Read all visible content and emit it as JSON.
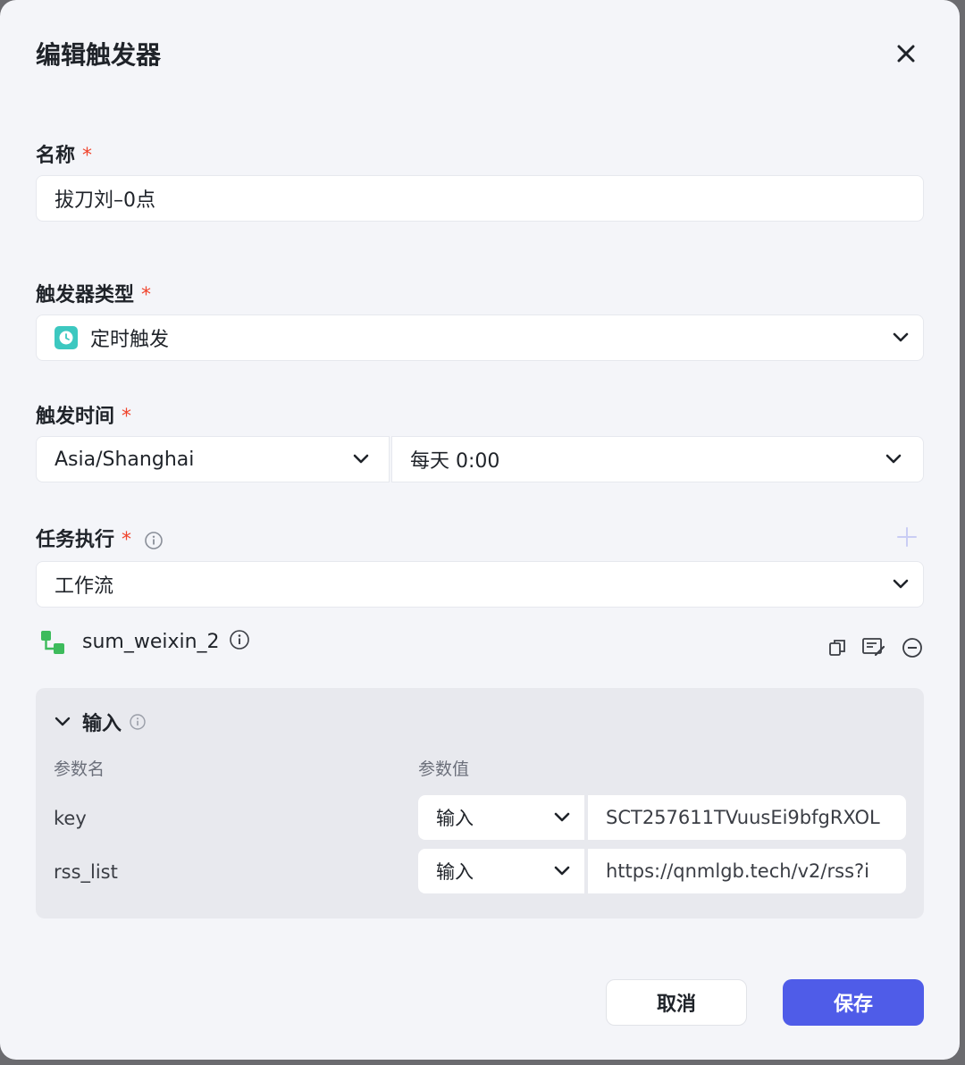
{
  "dialog": {
    "title": "编辑触发器"
  },
  "name_field": {
    "label": "名称",
    "required_mark": "*",
    "value": "拔刀刘–0点"
  },
  "trigger_type": {
    "label": "触发器类型",
    "required_mark": "*",
    "value": "定时触发",
    "icon": "clock-icon",
    "icon_color": "#3cc8c0"
  },
  "trigger_time": {
    "label": "触发时间",
    "required_mark": "*",
    "timezone": "Asia/Shanghai",
    "schedule": "每天 0:00"
  },
  "task": {
    "label": "任务执行",
    "required_mark": "*",
    "type": "工作流",
    "workflow_name": "sum_weixin_2",
    "workflow_icon_color": "#3dbb5c"
  },
  "inputs": {
    "title": "输入",
    "col_name": "参数名",
    "col_value": "参数值",
    "rows": [
      {
        "name": "key",
        "mode": "输入",
        "value": "SCT257611TVuusEi9bfgRXOL"
      },
      {
        "name": "rss_list",
        "mode": "输入",
        "value": "https://qnmlgb.tech/v2/rss?i"
      }
    ]
  },
  "footer": {
    "cancel": "取消",
    "save": "保存"
  },
  "colors": {
    "accent": "#4f5ce8",
    "required": "#f0442c",
    "add_icon": "#c9cdf4"
  }
}
